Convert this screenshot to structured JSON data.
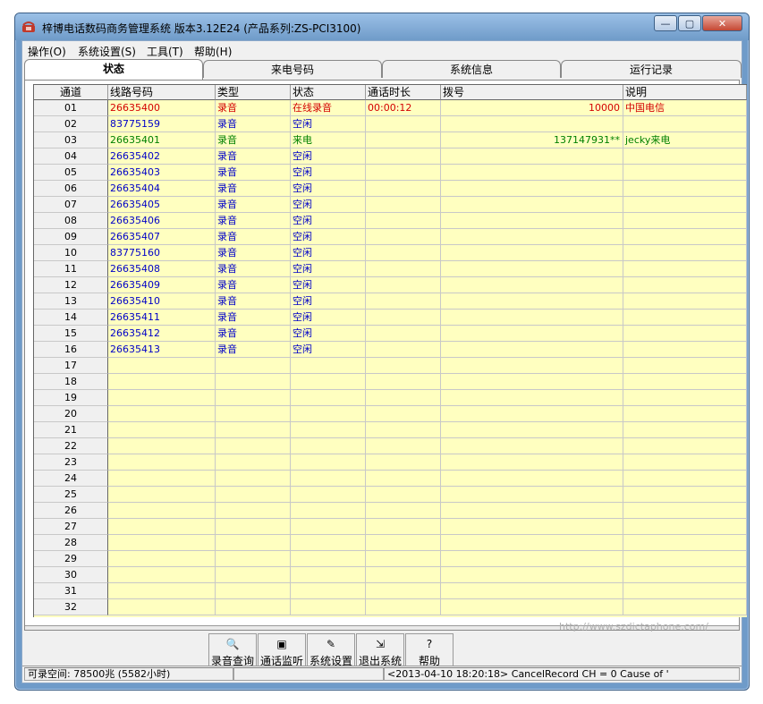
{
  "window": {
    "title": "梓博电话数码商务管理系统 版本3.12E24 (产品系列:ZS-PCI3100)",
    "controls": {
      "minimize": "—",
      "maximize": "▢",
      "close": "✕"
    }
  },
  "menu": [
    "操作(O)",
    "系统设置(S)",
    "工具(T)",
    "帮助(H)"
  ],
  "tabs": [
    {
      "label": "状态",
      "active": true
    },
    {
      "label": "来电号码",
      "active": false
    },
    {
      "label": "系统信息",
      "active": false
    },
    {
      "label": "运行记录",
      "active": false
    }
  ],
  "table": {
    "columns": [
      "通道",
      "线路号码",
      "类型",
      "状态",
      "通话时长",
      "拨号",
      "说明"
    ],
    "rows": [
      {
        "ch": "01",
        "line": "26635400",
        "type": "录音",
        "state": "在线录音",
        "dur": "00:00:12",
        "dial": "10000",
        "note": "中国电信",
        "tone": "active"
      },
      {
        "ch": "02",
        "line": "83775159",
        "type": "录音",
        "state": "空闲",
        "dur": "",
        "dial": "",
        "note": "",
        "tone": "idle"
      },
      {
        "ch": "03",
        "line": "26635401",
        "type": "录音",
        "state": "来电",
        "dur": "",
        "dial": "137147931**",
        "note": "jecky来电",
        "tone": "ring"
      },
      {
        "ch": "04",
        "line": "26635402",
        "type": "录音",
        "state": "空闲",
        "dur": "",
        "dial": "",
        "note": "",
        "tone": "idle"
      },
      {
        "ch": "05",
        "line": "26635403",
        "type": "录音",
        "state": "空闲",
        "dur": "",
        "dial": "",
        "note": "",
        "tone": "idle"
      },
      {
        "ch": "06",
        "line": "26635404",
        "type": "录音",
        "state": "空闲",
        "dur": "",
        "dial": "",
        "note": "",
        "tone": "idle"
      },
      {
        "ch": "07",
        "line": "26635405",
        "type": "录音",
        "state": "空闲",
        "dur": "",
        "dial": "",
        "note": "",
        "tone": "idle"
      },
      {
        "ch": "08",
        "line": "26635406",
        "type": "录音",
        "state": "空闲",
        "dur": "",
        "dial": "",
        "note": "",
        "tone": "idle"
      },
      {
        "ch": "09",
        "line": "26635407",
        "type": "录音",
        "state": "空闲",
        "dur": "",
        "dial": "",
        "note": "",
        "tone": "idle"
      },
      {
        "ch": "10",
        "line": "83775160",
        "type": "录音",
        "state": "空闲",
        "dur": "",
        "dial": "",
        "note": "",
        "tone": "idle"
      },
      {
        "ch": "11",
        "line": "26635408",
        "type": "录音",
        "state": "空闲",
        "dur": "",
        "dial": "",
        "note": "",
        "tone": "idle"
      },
      {
        "ch": "12",
        "line": "26635409",
        "type": "录音",
        "state": "空闲",
        "dur": "",
        "dial": "",
        "note": "",
        "tone": "idle"
      },
      {
        "ch": "13",
        "line": "26635410",
        "type": "录音",
        "state": "空闲",
        "dur": "",
        "dial": "",
        "note": "",
        "tone": "idle"
      },
      {
        "ch": "14",
        "line": "26635411",
        "type": "录音",
        "state": "空闲",
        "dur": "",
        "dial": "",
        "note": "",
        "tone": "idle"
      },
      {
        "ch": "15",
        "line": "26635412",
        "type": "录音",
        "state": "空闲",
        "dur": "",
        "dial": "",
        "note": "",
        "tone": "idle"
      },
      {
        "ch": "16",
        "line": "26635413",
        "type": "录音",
        "state": "空闲",
        "dur": "",
        "dial": "",
        "note": "",
        "tone": "idle"
      },
      {
        "ch": "17",
        "line": "",
        "type": "",
        "state": "",
        "dur": "",
        "dial": "",
        "note": "",
        "tone": "empty"
      },
      {
        "ch": "18",
        "line": "",
        "type": "",
        "state": "",
        "dur": "",
        "dial": "",
        "note": "",
        "tone": "empty"
      },
      {
        "ch": "19",
        "line": "",
        "type": "",
        "state": "",
        "dur": "",
        "dial": "",
        "note": "",
        "tone": "empty"
      },
      {
        "ch": "20",
        "line": "",
        "type": "",
        "state": "",
        "dur": "",
        "dial": "",
        "note": "",
        "tone": "empty"
      },
      {
        "ch": "21",
        "line": "",
        "type": "",
        "state": "",
        "dur": "",
        "dial": "",
        "note": "",
        "tone": "empty"
      },
      {
        "ch": "22",
        "line": "",
        "type": "",
        "state": "",
        "dur": "",
        "dial": "",
        "note": "",
        "tone": "empty"
      },
      {
        "ch": "23",
        "line": "",
        "type": "",
        "state": "",
        "dur": "",
        "dial": "",
        "note": "",
        "tone": "empty"
      },
      {
        "ch": "24",
        "line": "",
        "type": "",
        "state": "",
        "dur": "",
        "dial": "",
        "note": "",
        "tone": "empty"
      },
      {
        "ch": "25",
        "line": "",
        "type": "",
        "state": "",
        "dur": "",
        "dial": "",
        "note": "",
        "tone": "empty"
      },
      {
        "ch": "26",
        "line": "",
        "type": "",
        "state": "",
        "dur": "",
        "dial": "",
        "note": "",
        "tone": "empty"
      },
      {
        "ch": "27",
        "line": "",
        "type": "",
        "state": "",
        "dur": "",
        "dial": "",
        "note": "",
        "tone": "empty"
      },
      {
        "ch": "28",
        "line": "",
        "type": "",
        "state": "",
        "dur": "",
        "dial": "",
        "note": "",
        "tone": "empty"
      },
      {
        "ch": "29",
        "line": "",
        "type": "",
        "state": "",
        "dur": "",
        "dial": "",
        "note": "",
        "tone": "empty"
      },
      {
        "ch": "30",
        "line": "",
        "type": "",
        "state": "",
        "dur": "",
        "dial": "",
        "note": "",
        "tone": "empty"
      },
      {
        "ch": "31",
        "line": "",
        "type": "",
        "state": "",
        "dur": "",
        "dial": "",
        "note": "",
        "tone": "empty"
      },
      {
        "ch": "32",
        "line": "",
        "type": "",
        "state": "",
        "dur": "",
        "dial": "",
        "note": "",
        "tone": "empty"
      }
    ]
  },
  "colors": {
    "grid_bg": "#ffffc0",
    "active": "#d40000",
    "idle": "#0000c8",
    "ring": "#008000"
  },
  "toolbar": [
    {
      "label": "录音查询",
      "icon": "magnifier-icon",
      "glyph": "🔍"
    },
    {
      "label": "通话监听",
      "icon": "monitor-icon",
      "glyph": "▣"
    },
    {
      "label": "系统设置",
      "icon": "settings-icon",
      "glyph": "✎"
    },
    {
      "label": "退出系统",
      "icon": "exit-door-icon",
      "glyph": "⇲"
    },
    {
      "label": "帮助",
      "icon": "help-icon",
      "glyph": "?"
    }
  ],
  "watermark": "http://www.szdictaphone.com/",
  "status": {
    "space": "可录空间: 78500兆 (5582小时)",
    "blank": "",
    "log": "<2013-04-10 18:20:18> CancelRecord CH = 0 Cause of '"
  }
}
